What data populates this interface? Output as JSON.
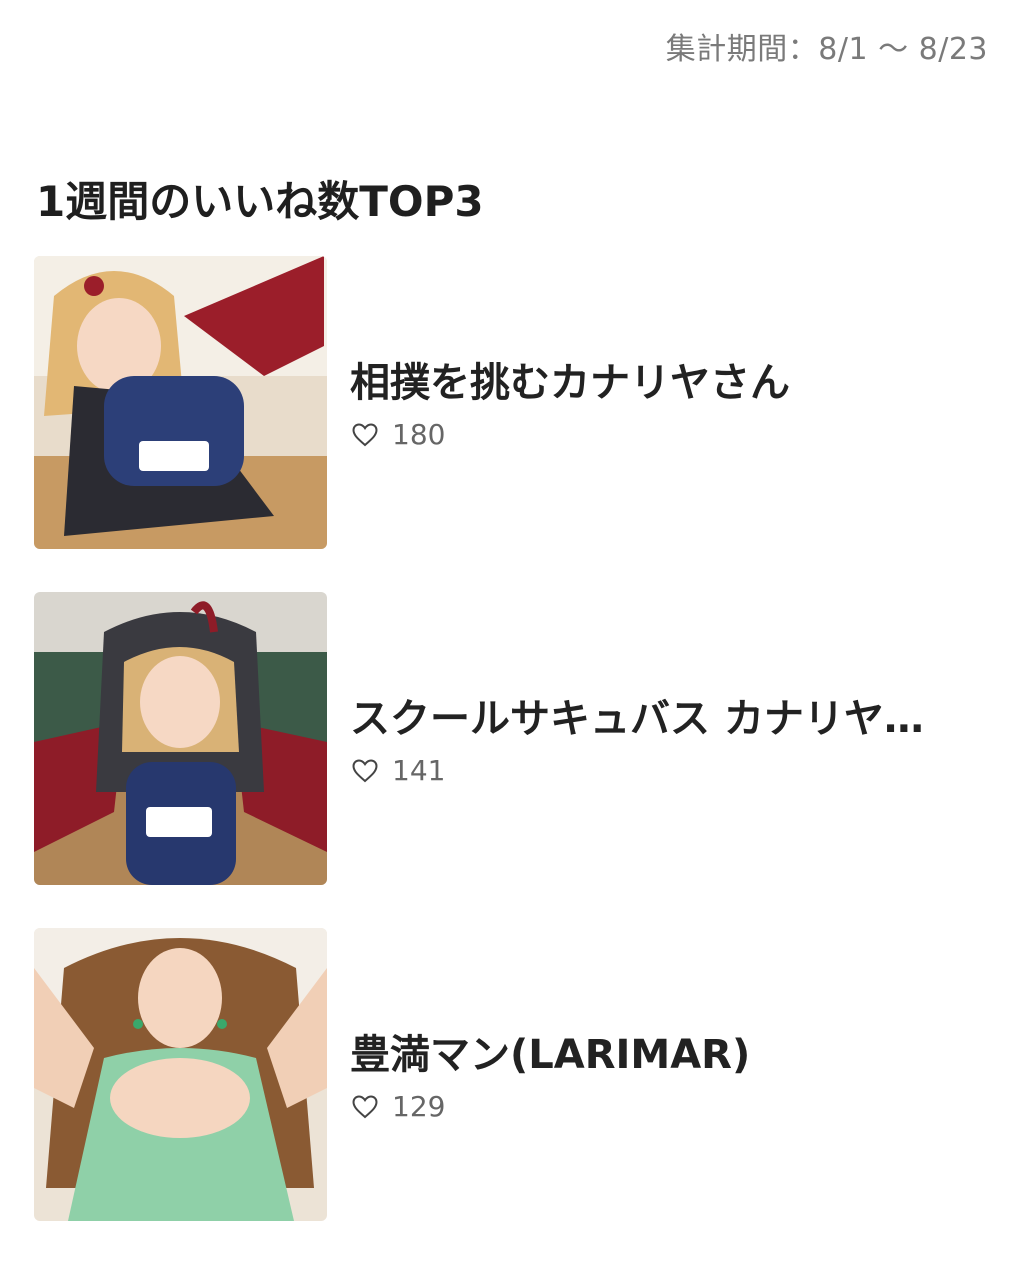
{
  "period": "集計期間：8/1 〜 8/23",
  "heading": "1週間のいいね数TOP3",
  "items": [
    {
      "title": "相撲を挑むカナリヤさん",
      "likes": "180",
      "icon": "heart-icon",
      "thumb_colors": {
        "bg": "#e7d3bd",
        "hair": "#e2b774",
        "outfit": "#2c3f78",
        "wing": "#9b1e2a"
      }
    },
    {
      "title": "スクールサキュバス カナリヤ…",
      "likes": "141",
      "icon": "heart-icon",
      "thumb_colors": {
        "bg": "#d9d6cf",
        "hair": "#d9b276",
        "outfit": "#27386e",
        "wing": "#8e1c28"
      }
    },
    {
      "title": "豊満マン(LARIMAR)",
      "likes": "129",
      "icon": "heart-icon",
      "thumb_colors": {
        "bg": "#ece3d6",
        "hair": "#8a5a33",
        "outfit": "#8fd0a8",
        "wing": "#f1cfb6"
      }
    }
  ]
}
